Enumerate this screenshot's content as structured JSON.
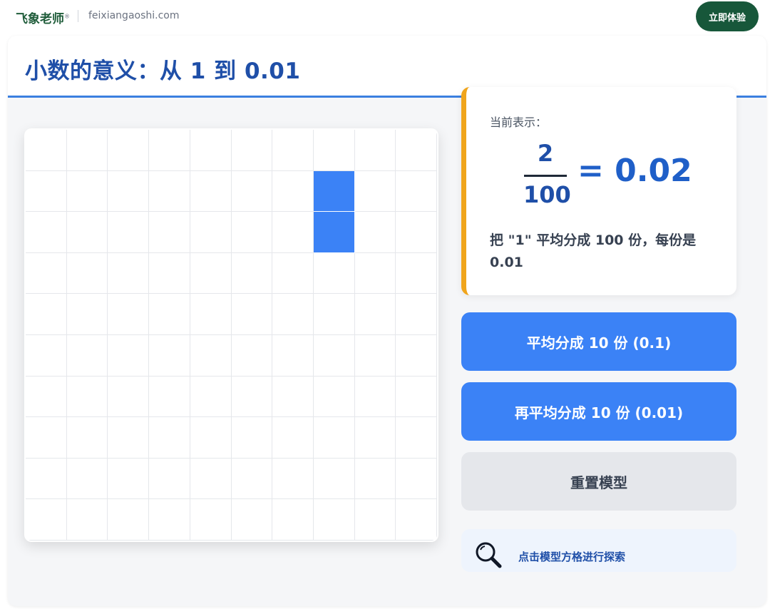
{
  "brand": {
    "name": "飞象老师",
    "registered": "®",
    "domain": "feixiangaoshi.com",
    "trial_label": "立即体验"
  },
  "page": {
    "title": "小数的意义：从 1 到 0.01"
  },
  "model": {
    "rows": 10,
    "columns": 10,
    "filled_cells": [
      [
        1,
        7
      ],
      [
        2,
        7
      ]
    ]
  },
  "info": {
    "label": "当前表示：",
    "numerator": "2",
    "denominator": "100",
    "equals": "= 0.02",
    "description": "把 \"1\" 平均分成 100 份，每份是 0.01"
  },
  "buttons": {
    "split10": "平均分成 10 份 (0.1)",
    "split100": "再平均分成 10 份 (0.01)",
    "reset": "重置模型"
  },
  "hint": {
    "icon": "magnifier-icon",
    "text": "点击模型方格进行探索"
  },
  "colors": {
    "accent": "#3b82f6",
    "title": "#1f4fa8",
    "highlight_border": "#f0a51c",
    "brand_green": "#17573a"
  }
}
